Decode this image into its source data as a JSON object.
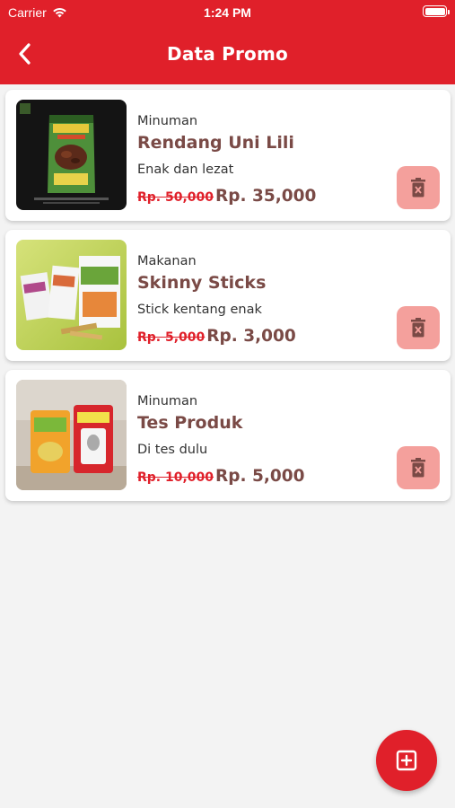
{
  "status_bar": {
    "carrier": "Carrier",
    "time": "1:24 PM"
  },
  "header": {
    "title": "Data Promo"
  },
  "colors": {
    "primary": "#e0202a",
    "name_text": "#7a4a46",
    "delete_bg": "#f4a09c"
  },
  "promos": [
    {
      "category": "Minuman",
      "name": "Rendang Uni Lili",
      "description": "Enak dan lezat",
      "old_price": "Rp. 50,000",
      "new_price": "Rp. 35,000"
    },
    {
      "category": "Makanan",
      "name": "Skinny Sticks",
      "description": "Stick kentang enak",
      "old_price": "Rp. 5,000",
      "new_price": "Rp. 3,000"
    },
    {
      "category": "Minuman",
      "name": "Tes Produk",
      "description": "Di tes dulu",
      "old_price": "Rp. 10,000",
      "new_price": "Rp. 5,000"
    }
  ],
  "icons": {
    "back": "chevron-left-icon",
    "delete": "trash-icon",
    "add": "add-box-icon"
  }
}
